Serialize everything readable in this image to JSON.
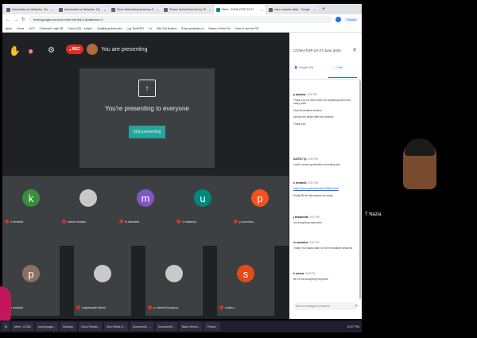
{
  "browser": {
    "tabs": [
      {
        "title": "Introduction to Networks- Cis"
      },
      {
        "title": "Introduction to Networks- Cis"
      },
      {
        "title": "Cisco Networking Academy D"
      },
      {
        "title": "Please Submit the form by 25"
      },
      {
        "title": "Meet - CCNA-ITDP-22-27",
        "active": true
      },
      {
        "title": "cisco console cable - Google"
      }
    ],
    "url": "meet.google.com/cvf-mfnn-bfn?pli=1&authuser=1",
    "paused_label": "Paused",
    "bookmarks": [
      "Apps",
      "Home",
      "ACS",
      "Customer Login 3B",
      "Cisco ASA : Juniper",
      "Qualifying Networks",
      "Log TechPRO",
      "Yo",
      "Will Call System",
      "8 key principles of",
      "Basics of New Ro",
      "How to use the RD"
    ]
  },
  "meet": {
    "rec_label": "REC",
    "presenting_label": "You are presenting",
    "present_card": {
      "message": "You're presenting to everyone",
      "stop_label": "Stop presenting"
    },
    "participants": [
      {
        "initial": "k",
        "name": "k hemanth",
        "color": "#388e3c"
      },
      {
        "initial": "",
        "name": "sadulu madipa",
        "color": "#c9c9c9"
      },
      {
        "initial": "m",
        "name": "m ramadevi",
        "color": "#7e57c2"
      },
      {
        "initial": "u",
        "name": "u chaitanya",
        "color": "#00897b"
      },
      {
        "initial": "p",
        "name": "p poornima",
        "color": "#f4511e"
      },
      {
        "initial": "p",
        "name": "p madhavi",
        "color": "#8d6e63"
      },
      {
        "initial": "",
        "name": "kupparapalli lokesh",
        "color": "#c9c9c9"
      },
      {
        "initial": "",
        "name": "p v lakshmi prasuna",
        "color": "#c9c9c9"
      },
      {
        "initial": "s",
        "name": "sudha s",
        "color": "#e64a19"
      }
    ]
  },
  "panel": {
    "title": "CCNA-ITDP-22-27 June 2020",
    "tab_people": "People (20)",
    "tab_chat": "Chat",
    "messages": [
      {
        "who": "p abhisha",
        "time": "4:50 PM",
        "lines": [
          "Thank you so much mam for explaining each and every point",
          "Very informative session",
          "Upload the slides after the session",
          "Thank you"
        ]
      },
      {
        "who": "SAITEJ Tp",
        "time": "4:50 PM",
        "lines": [
          "could u share yesterday's recording also"
        ]
      },
      {
        "who": "k hemanth",
        "time": "5:51 PM",
        "link": "https://forms.gle/xxaNndbxaPBEuVbz9",
        "lines": [
          "Kindly fill the Attendance for today"
        ]
      },
      {
        "who": "j bezadevila",
        "time": "5:51 PM",
        "lines": [
          "not accepting responses"
        ]
      },
      {
        "who": "m ramadevi",
        "time": "5:57 PM",
        "lines": [
          "Thank You Nazia mam for the informative sessions"
        ]
      },
      {
        "who": "k mecha",
        "time": "5:56 PM",
        "lines": [
          "till it is not accepting response"
        ]
      }
    ],
    "input_placeholder": "Send a message to everyone"
  },
  "right_video": {
    "name": "T Nazia"
  },
  "taskbar": {
    "items": [
      "Meet - CCNA",
      "meet.google...",
      "Desktop",
      "",
      "Cisco Packet...",
      "",
      "Zero Week O...",
      "Document1 -...",
      "Document2...",
      "Batch Servic...",
      "Photos"
    ],
    "time": "5:57 PM"
  }
}
